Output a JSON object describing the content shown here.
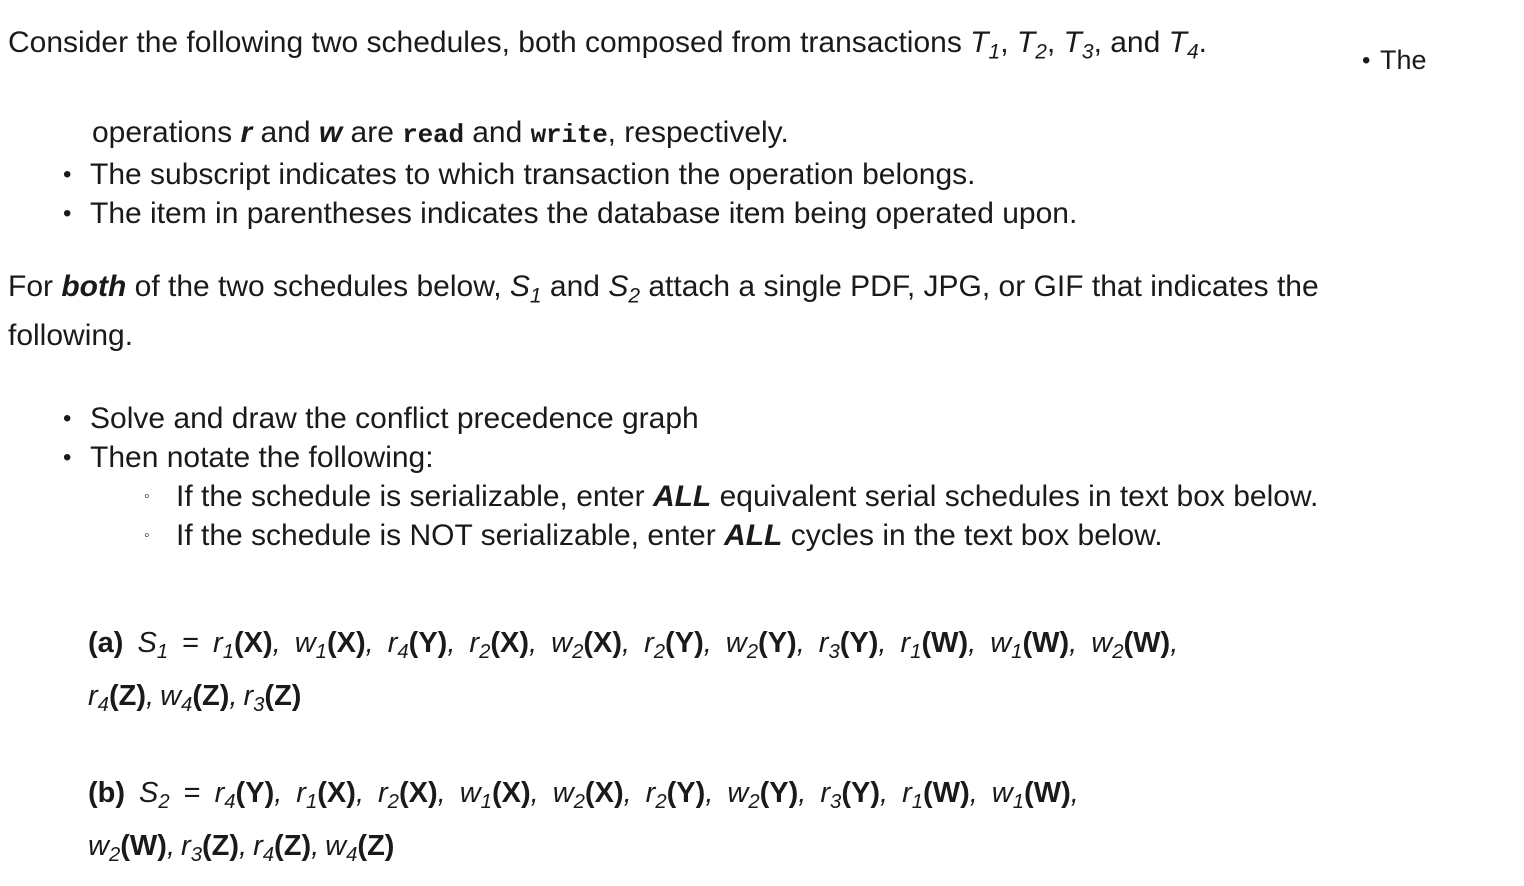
{
  "document": {
    "intro": {
      "before_transactions": "Consider the following two schedules, both composed from transactions ",
      "transaction_labels": [
        "T",
        "T",
        "T",
        "T"
      ],
      "transaction_subs": [
        "1",
        "2",
        "3",
        "4"
      ],
      "sep_comma": ", ",
      "sep_and": ", and ",
      "period": ".",
      "trailing_bullet_text": "The",
      "trailing_bullet_marker": "•"
    },
    "ops_note": {
      "continuation_prefix": "operations ",
      "op_read_symbol": "r",
      "mid_and": " and ",
      "op_write_symbol": "w",
      "are_text": " are ",
      "read_keyword": "read",
      "and_text": " and ",
      "write_keyword": "write",
      "suffix": ", respectively."
    },
    "ops_bullets": [
      {
        "marker": "•",
        "text": "The subscript indicates to which transaction the operation belongs."
      },
      {
        "marker": "•",
        "text": "The item in parentheses indicates the database item being operated upon."
      }
    ],
    "forboth": {
      "part1": "For ",
      "bold_both": "both",
      "part2": " of the two schedules below, ",
      "s1_label": "S",
      "s1_sub": "1",
      "part3": " and ",
      "s2_label": "S",
      "s2_sub": "2",
      "part4": " attach a single PDF, JPG, or GIF that indicates the",
      "line2": "following."
    },
    "task_bullets": [
      {
        "marker": "•",
        "text": "Solve and draw the conflict precedence graph"
      },
      {
        "marker": "•",
        "text": "Then notate the following:"
      }
    ],
    "task_subbullets": [
      {
        "marker": "◦",
        "part1": "If the schedule is serializable, enter ",
        "emphasis": "ALL",
        "part2": " equivalent serial schedules in text box below."
      },
      {
        "marker": "◦",
        "part1": "If the schedule is NOT serializable, enter ",
        "emphasis": "ALL",
        "part2": " cycles in the text box below."
      }
    ],
    "schedules": [
      {
        "label": "(a)",
        "name": "S",
        "name_sub": "1",
        "equals": "=",
        "operations_line1": "r1(X),  w1(X),  r4(Y),  r2(X),  w2(X),  r2(Y),  w2(Y),  r3(Y),  r1(W),  w1(W),  w2(W),",
        "operations_line2": "r4(Z), w4(Z), r3(Z)",
        "operations": [
          {
            "op": "r",
            "sub": "1",
            "item": "X"
          },
          {
            "op": "w",
            "sub": "1",
            "item": "X"
          },
          {
            "op": "r",
            "sub": "4",
            "item": "Y"
          },
          {
            "op": "r",
            "sub": "2",
            "item": "X"
          },
          {
            "op": "w",
            "sub": "2",
            "item": "X"
          },
          {
            "op": "r",
            "sub": "2",
            "item": "Y"
          },
          {
            "op": "w",
            "sub": "2",
            "item": "Y"
          },
          {
            "op": "r",
            "sub": "3",
            "item": "Y"
          },
          {
            "op": "r",
            "sub": "1",
            "item": "W"
          },
          {
            "op": "w",
            "sub": "1",
            "item": "W"
          },
          {
            "op": "w",
            "sub": "2",
            "item": "W"
          },
          {
            "op": "r",
            "sub": "4",
            "item": "Z"
          },
          {
            "op": "w",
            "sub": "4",
            "item": "Z"
          },
          {
            "op": "r",
            "sub": "3",
            "item": "Z"
          }
        ],
        "wrap_after_index": 11
      },
      {
        "label": "(b)",
        "name": "S",
        "name_sub": "2",
        "equals": "=",
        "operations_line1": "r4(Y),  r1(X),  r2(X),  w1(X),  w2(X),  r2(Y),  w2(Y),  r3(Y),  r1(W),  w1(W),",
        "operations_line2": "w2(W), r3(Z), r4(Z), w4(Z)",
        "operations": [
          {
            "op": "r",
            "sub": "4",
            "item": "Y"
          },
          {
            "op": "r",
            "sub": "1",
            "item": "X"
          },
          {
            "op": "r",
            "sub": "2",
            "item": "X"
          },
          {
            "op": "w",
            "sub": "1",
            "item": "X"
          },
          {
            "op": "w",
            "sub": "2",
            "item": "X"
          },
          {
            "op": "r",
            "sub": "2",
            "item": "Y"
          },
          {
            "op": "w",
            "sub": "2",
            "item": "Y"
          },
          {
            "op": "r",
            "sub": "3",
            "item": "Y"
          },
          {
            "op": "r",
            "sub": "1",
            "item": "W"
          },
          {
            "op": "w",
            "sub": "1",
            "item": "W"
          },
          {
            "op": "w",
            "sub": "2",
            "item": "W"
          },
          {
            "op": "r",
            "sub": "3",
            "item": "Z"
          },
          {
            "op": "r",
            "sub": "4",
            "item": "Z"
          },
          {
            "op": "w",
            "sub": "4",
            "item": "Z"
          }
        ],
        "wrap_after_index": 10
      }
    ],
    "colors": {
      "text": "#1a1a1a",
      "background": "#ffffff"
    }
  }
}
